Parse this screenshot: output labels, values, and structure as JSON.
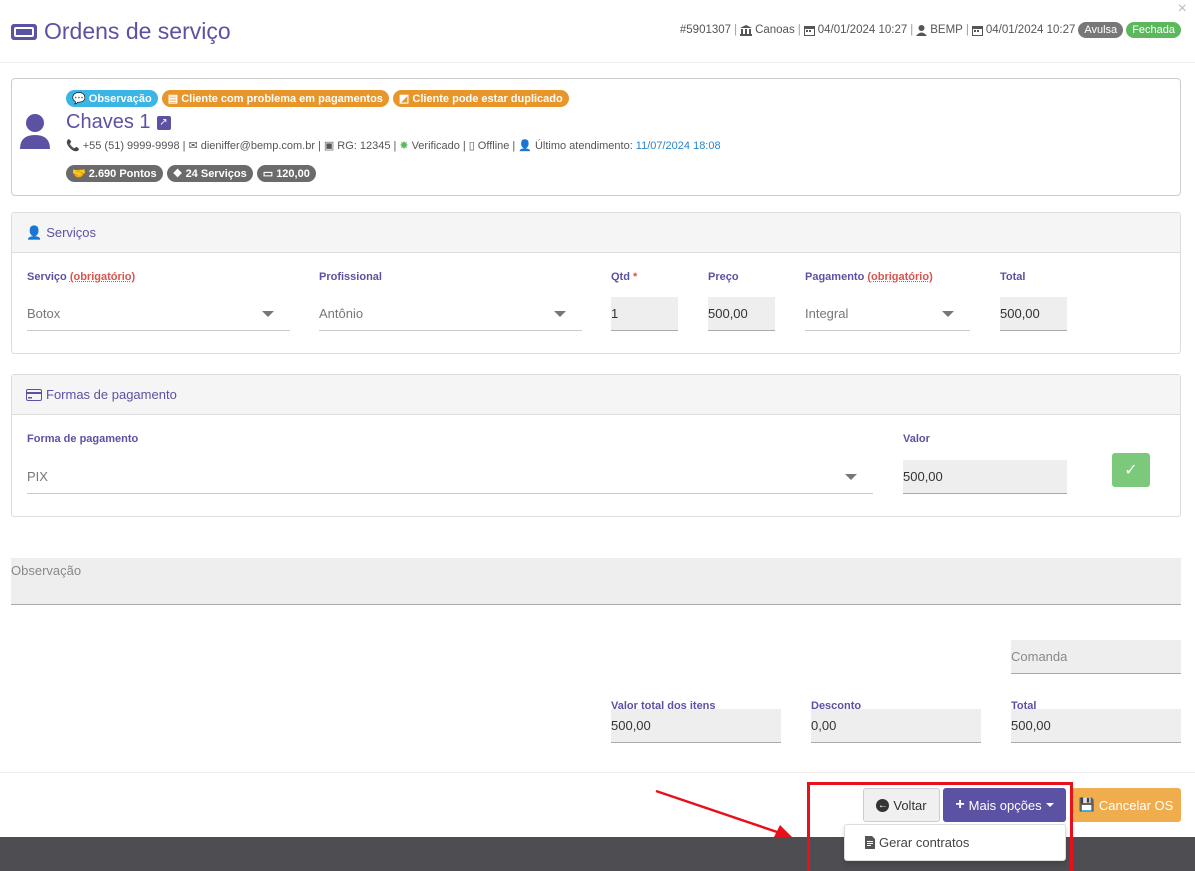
{
  "header": {
    "title": "Ordens de serviço",
    "order_id": "#5901307",
    "location": "Canoas",
    "created": "04/01/2024 10:27",
    "user": "BEMP",
    "closed": "04/01/2024 10:27",
    "badge_type": "Avulsa",
    "badge_status": "Fechada",
    "close_symbol": "×"
  },
  "client": {
    "tags": [
      "Observação",
      "Cliente com problema em pagamentos",
      "Cliente pode estar duplicado"
    ],
    "name": "Chaves 1",
    "phone": "+55 (51) 9999-9998",
    "email": "dieniffer@bemp.com.br",
    "rg": "RG: 12345",
    "verified": "Verificado",
    "status": "Offline",
    "last_visit_label": "Último atendimento:",
    "last_visit": "11/07/2024 18:08",
    "stats": [
      "2.690 Pontos",
      "24 Serviços",
      "120,00"
    ]
  },
  "services": {
    "title": "Serviços",
    "labels": {
      "service": "Serviço",
      "required": "(obrigatório)",
      "professional": "Profissional",
      "qty": "Qtd",
      "qty_star": "*",
      "price": "Preço",
      "payment": "Pagamento",
      "total": "Total"
    },
    "values": {
      "service": "Botox",
      "professional": "Antônio",
      "qty": "1",
      "price": "500,00",
      "payment": "Integral",
      "total": "500,00"
    }
  },
  "payments": {
    "title": "Formas de pagamento",
    "method_label": "Forma de pagamento",
    "method": "PIX",
    "value_label": "Valor",
    "value": "500,00"
  },
  "observation_placeholder": "Observação",
  "comanda_placeholder": "Comanda",
  "totals": {
    "items_label": "Valor total dos itens",
    "items": "500,00",
    "discount_label": "Desconto",
    "discount": "0,00",
    "total_label": "Total",
    "total": "500,00"
  },
  "actions": {
    "back": "Voltar",
    "more": "Mais opções",
    "cancel": "Cancelar OS",
    "dropdown_item": "Gerar contratos"
  },
  "colors": {
    "brand": "#5b52a3",
    "success": "#5cb85c",
    "warning": "#f0ad4e",
    "annotation": "#e8101a"
  }
}
